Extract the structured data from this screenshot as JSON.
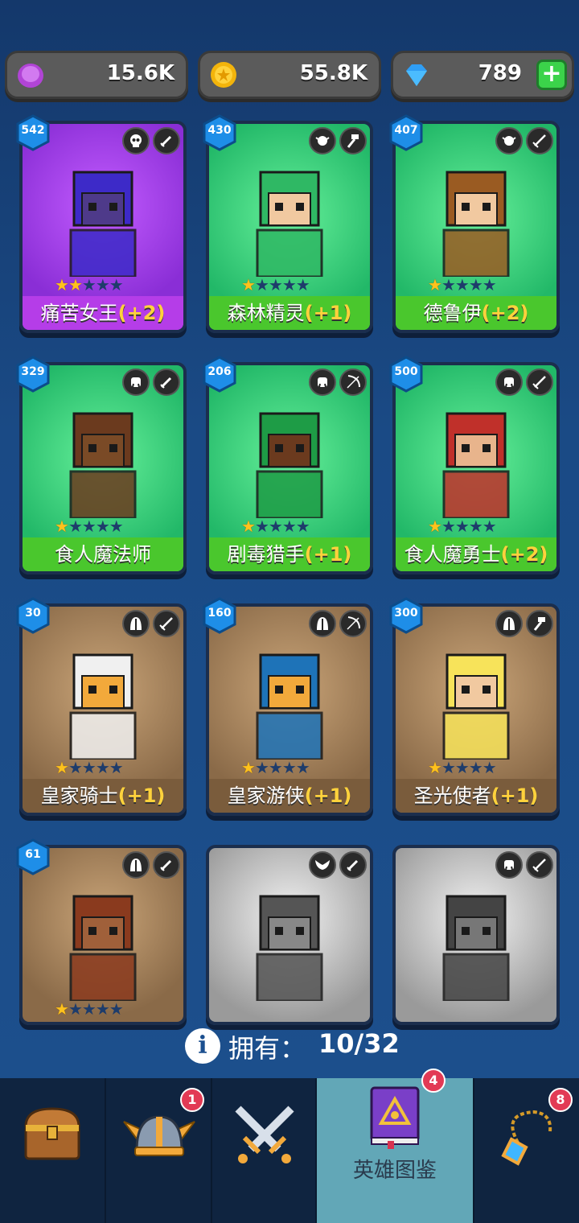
{
  "currency": {
    "gems_purple": "15.6K",
    "gold": "55.8K",
    "diamonds": "789",
    "add_label": "+"
  },
  "heroes": [
    {
      "name": "痛苦女王",
      "bonus": "(+2)",
      "level": "542",
      "stars": 2,
      "rarity": "epic",
      "class_icon": "skull-icon",
      "weapon_icon": "dagger-icon"
    },
    {
      "name": "森林精灵",
      "bonus": "(+1)",
      "level": "430",
      "stars": 1,
      "rarity": "green",
      "class_icon": "elf-icon",
      "weapon_icon": "hammer-icon"
    },
    {
      "name": "德鲁伊",
      "bonus": "(+2)",
      "level": "407",
      "stars": 1,
      "rarity": "green",
      "class_icon": "elf-icon",
      "weapon_icon": "sword-icon"
    },
    {
      "name": "食人魔法师",
      "bonus": "",
      "level": "329",
      "stars": 1,
      "rarity": "green",
      "class_icon": "orc-icon",
      "weapon_icon": "dagger-icon"
    },
    {
      "name": "剧毒猎手",
      "bonus": "(+1)",
      "level": "206",
      "stars": 1,
      "rarity": "green",
      "class_icon": "orc-icon",
      "weapon_icon": "bow-icon"
    },
    {
      "name": "食人魔勇士",
      "bonus": "(+2)",
      "level": "500",
      "stars": 1,
      "rarity": "green",
      "class_icon": "orc-icon",
      "weapon_icon": "sword-icon"
    },
    {
      "name": "皇家骑士",
      "bonus": "(+1)",
      "level": "30",
      "stars": 1,
      "rarity": "brown",
      "class_icon": "helmet-icon",
      "weapon_icon": "sword-icon"
    },
    {
      "name": "皇家游侠",
      "bonus": "(+1)",
      "level": "160",
      "stars": 1,
      "rarity": "brown",
      "class_icon": "helmet-icon",
      "weapon_icon": "bow-icon"
    },
    {
      "name": "圣光使者",
      "bonus": "(+1)",
      "level": "300",
      "stars": 1,
      "rarity": "brown",
      "class_icon": "helmet-icon",
      "weapon_icon": "hammer-icon"
    },
    {
      "name": "",
      "bonus": "",
      "level": "61",
      "stars": 1,
      "rarity": "brown",
      "class_icon": "helmet-icon",
      "weapon_icon": "dagger-icon"
    },
    {
      "name": "",
      "bonus": "",
      "level": "",
      "stars": 0,
      "rarity": "gray",
      "class_icon": "wings-icon",
      "weapon_icon": "dagger-icon"
    },
    {
      "name": "",
      "bonus": "",
      "level": "",
      "stars": 0,
      "rarity": "gray",
      "class_icon": "orc-icon",
      "weapon_icon": "sword-icon"
    }
  ],
  "ownership": {
    "label": "拥有：",
    "count": "10/32"
  },
  "nav": {
    "tabs": [
      {
        "icon": "treasure-chest-icon",
        "label": "",
        "badge": ""
      },
      {
        "icon": "viking-helmet-icon",
        "label": "",
        "badge": "1"
      },
      {
        "icon": "crossed-swords-icon",
        "label": "",
        "badge": ""
      },
      {
        "icon": "spellbook-icon",
        "label": "英雄图鉴",
        "badge": "4"
      },
      {
        "icon": "amulet-icon",
        "label": "",
        "badge": "8"
      }
    ]
  },
  "colors": {
    "accent_gold": "#ffd23c",
    "active_tab": "#62a7b7",
    "badge_red": "#e23a55"
  }
}
